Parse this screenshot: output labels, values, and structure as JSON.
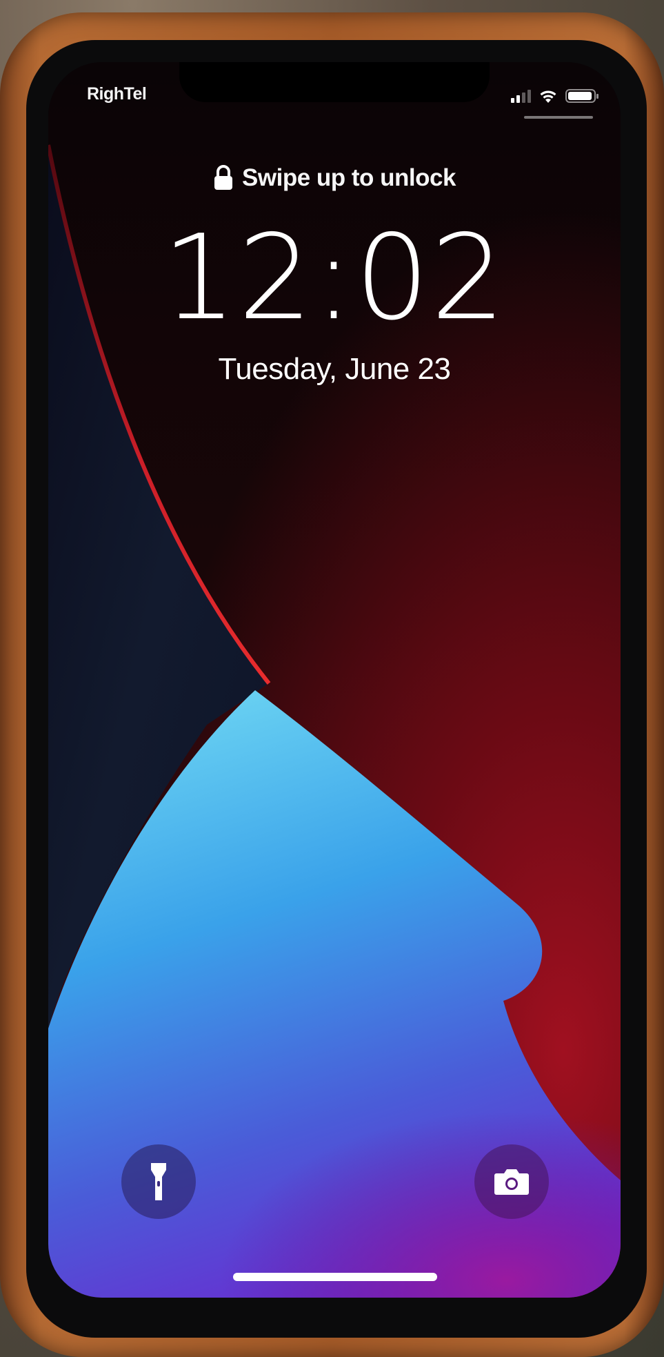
{
  "status_bar": {
    "carrier": "RighTel",
    "battery_level": 0.95,
    "signal_bars_active": 2,
    "signal_bars_total": 4
  },
  "lock_screen": {
    "unlock_hint": "Swipe up to unlock",
    "time": "12:02",
    "date": "Tuesday, June 23"
  },
  "quick_actions": {
    "left_icon": "flashlight-icon",
    "right_icon": "camera-icon"
  },
  "icons": {
    "lock": "lock-icon",
    "wifi": "wifi-icon",
    "battery": "battery-icon",
    "signal": "signal-icon"
  },
  "colors": {
    "wallpaper_red": "#c0182a",
    "wallpaper_blue": "#3a8fe0",
    "wallpaper_purple": "#6a2bd0",
    "case_leather": "#a45a28"
  }
}
